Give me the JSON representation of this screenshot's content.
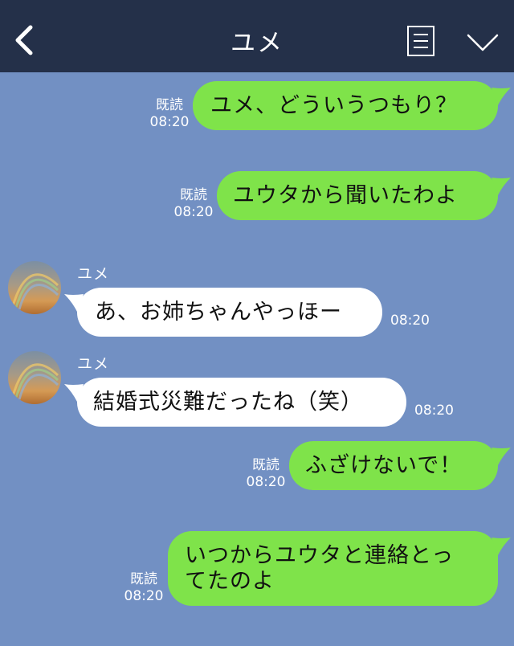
{
  "header": {
    "title": "ユメ",
    "back_icon": "chevron-left-icon",
    "menu_icon": "menu-icon",
    "expand_icon": "chevron-down-icon"
  },
  "colors": {
    "header_bg": "#243049",
    "chat_bg": "#7290c3",
    "outgoing_bubble": "#7fe34a",
    "incoming_bubble": "#ffffff"
  },
  "messages": [
    {
      "direction": "outgoing",
      "text": "ユメ、どういうつもり？",
      "read_label": "既読",
      "time": "08:20"
    },
    {
      "direction": "outgoing",
      "text": "ユウタから聞いたわよ",
      "read_label": "既読",
      "time": "08:20"
    },
    {
      "direction": "incoming",
      "sender": "ユメ",
      "text": "あ、お姉ちゃんやっほー",
      "time": "08:20"
    },
    {
      "direction": "incoming",
      "sender": "ユメ",
      "text": "結婚式災難だったね（笑）",
      "time": "08:20"
    },
    {
      "direction": "outgoing",
      "text": "ふざけないで！",
      "read_label": "既読",
      "time": "08:20"
    },
    {
      "direction": "outgoing",
      "text": "いつからユウタと連絡とっ\nてたのよ",
      "read_label": "既読",
      "time": "08:20"
    }
  ]
}
